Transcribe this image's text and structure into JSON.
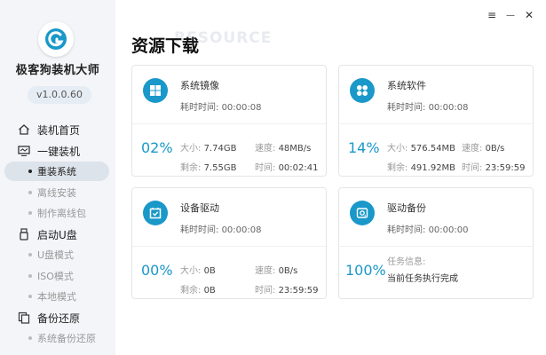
{
  "window": {
    "menu_icon": "≡",
    "minimize_icon": "—",
    "close_icon": "✕"
  },
  "app": {
    "name": "极客狗装机大师",
    "version": "v1.0.0.60"
  },
  "sidebar": {
    "home": "装机首页",
    "one_click": {
      "label": "一键装机",
      "items": [
        "重装系统",
        "离线安装",
        "制作离线包"
      ],
      "active": "重装系统"
    },
    "usb": {
      "label": "启动U盘",
      "items": [
        "U盘模式",
        "ISO模式",
        "本地模式"
      ]
    },
    "backup": {
      "label": "备份还原",
      "items": [
        "系统备份还原"
      ]
    }
  },
  "main": {
    "title": "资源下载",
    "watermark": "RESOURCE",
    "cards": [
      {
        "title": "系统镜像",
        "time_label": "耗时时间:",
        "time": "00:00:08",
        "percent": "02%",
        "size_label": "大小:",
        "size": "7.74GB",
        "speed_label": "速度:",
        "speed": "48MB/s",
        "remain_label": "剩余:",
        "remain": "7.55GB",
        "eta_label": "时间:",
        "eta": "00:02:41"
      },
      {
        "title": "系统软件",
        "time_label": "耗时时间:",
        "time": "00:00:08",
        "percent": "14%",
        "size_label": "大小:",
        "size": "576.54MB",
        "speed_label": "速度:",
        "speed": "0B/s",
        "remain_label": "剩余:",
        "remain": "491.92MB",
        "eta_label": "时间:",
        "eta": "23:59:59"
      },
      {
        "title": "设备驱动",
        "time_label": "耗时时间:",
        "time": "00:00:08",
        "percent": "00%",
        "size_label": "大小:",
        "size": "0B",
        "speed_label": "速度:",
        "speed": "0B/s",
        "remain_label": "剩余:",
        "remain": "0B",
        "eta_label": "时间:",
        "eta": "23:59:59"
      },
      {
        "title": "驱动备份",
        "time_label": "耗时时间:",
        "time": "00:00:00",
        "percent": "100%",
        "task_label": "任务信息:",
        "task_status": "当前任务执行完成"
      }
    ]
  },
  "colors": {
    "accent": "#1a98c9",
    "sidebar_bg": "#f3f5f8",
    "active_bg": "#dde3ea"
  }
}
